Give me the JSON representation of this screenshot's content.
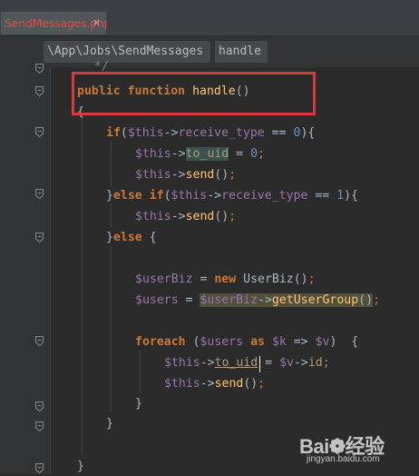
{
  "editor_tab": {
    "filename": "SendMessages.php",
    "close_glyph": "×"
  },
  "breadcrumb": {
    "path": "\\App\\Jobs\\SendMessages",
    "method": "handle"
  },
  "code": {
    "lines": [
      {
        "segments": [
          {
            "t": "  */",
            "c": "cm"
          }
        ]
      },
      {
        "segments": [
          {
            "t": "public",
            "c": "kw"
          },
          {
            "t": " ",
            "c": "pl"
          },
          {
            "t": "function",
            "c": "kw"
          },
          {
            "t": " ",
            "c": "pl"
          },
          {
            "t": "handle",
            "c": "fn"
          },
          {
            "t": "()",
            "c": "pl"
          }
        ]
      },
      {
        "segments": [
          {
            "t": "{",
            "c": "pl"
          }
        ]
      },
      {
        "segments": [
          {
            "t": "if",
            "c": "kw"
          },
          {
            "t": "(",
            "c": "pl"
          },
          {
            "t": "$this",
            "c": "var"
          },
          {
            "t": "->",
            "c": "op"
          },
          {
            "t": "receive_type",
            "c": "var"
          },
          {
            "t": " == ",
            "c": "pl"
          },
          {
            "t": "0",
            "c": "num"
          },
          {
            "t": "){",
            "c": "pl"
          }
        ]
      },
      {
        "segments": [
          {
            "t": "$this",
            "c": "var"
          },
          {
            "t": "->",
            "c": "op"
          },
          {
            "t": "to_uid",
            "c": "mth hl"
          },
          {
            "t": " = ",
            "c": "pl"
          },
          {
            "t": "0",
            "c": "num"
          },
          {
            "t": ";",
            "c": "sc"
          }
        ]
      },
      {
        "segments": [
          {
            "t": "$this",
            "c": "var"
          },
          {
            "t": "->",
            "c": "op"
          },
          {
            "t": "send",
            "c": "fn"
          },
          {
            "t": "()",
            "c": "pl"
          },
          {
            "t": ";",
            "c": "sc"
          }
        ]
      },
      {
        "segments": [
          {
            "t": "}",
            "c": "pl"
          },
          {
            "t": "else",
            "c": "kw"
          },
          {
            "t": " ",
            "c": "pl"
          },
          {
            "t": "if",
            "c": "kw"
          },
          {
            "t": "(",
            "c": "pl"
          },
          {
            "t": "$this",
            "c": "var"
          },
          {
            "t": "->",
            "c": "op"
          },
          {
            "t": "receive_type",
            "c": "var"
          },
          {
            "t": " == ",
            "c": "pl"
          },
          {
            "t": "1",
            "c": "num"
          },
          {
            "t": "){",
            "c": "pl"
          }
        ]
      },
      {
        "segments": [
          {
            "t": "$this",
            "c": "var"
          },
          {
            "t": "->",
            "c": "op"
          },
          {
            "t": "send",
            "c": "fn"
          },
          {
            "t": "()",
            "c": "pl"
          },
          {
            "t": ";",
            "c": "sc"
          }
        ]
      },
      {
        "segments": [
          {
            "t": "}",
            "c": "pl"
          },
          {
            "t": "else",
            "c": "kw"
          },
          {
            "t": " {",
            "c": "pl"
          }
        ]
      },
      {
        "segments": []
      },
      {
        "segments": [
          {
            "t": "$userBiz",
            "c": "var"
          },
          {
            "t": " = ",
            "c": "pl"
          },
          {
            "t": "new",
            "c": "kw"
          },
          {
            "t": " UserBiz()",
            "c": "pl"
          },
          {
            "t": ";",
            "c": "sc"
          }
        ]
      },
      {
        "segments": [
          {
            "t": "$users",
            "c": "var"
          },
          {
            "t": " = ",
            "c": "pl"
          },
          {
            "t": "$userBiz",
            "c": "var hlr"
          },
          {
            "t": "->",
            "c": "op hlr"
          },
          {
            "t": "getUserGroup",
            "c": "fn hlr"
          },
          {
            "t": "()",
            "c": "pl hlr"
          },
          {
            "t": ";",
            "c": "sc"
          }
        ]
      },
      {
        "segments": []
      },
      {
        "segments": [
          {
            "t": "foreach",
            "c": "kw"
          },
          {
            "t": " (",
            "c": "pl"
          },
          {
            "t": "$users",
            "c": "var"
          },
          {
            "t": " ",
            "c": "pl"
          },
          {
            "t": "as",
            "c": "kw"
          },
          {
            "t": " ",
            "c": "pl"
          },
          {
            "t": "$k",
            "c": "var"
          },
          {
            "t": " => ",
            "c": "pl"
          },
          {
            "t": "$v",
            "c": "var"
          },
          {
            "t": ")  {",
            "c": "pl"
          }
        ]
      },
      {
        "segments": [
          {
            "t": "$this",
            "c": "var"
          },
          {
            "t": "->",
            "c": "op"
          },
          {
            "t": "to_uid",
            "c": "mth ud"
          },
          {
            "t": " = ",
            "c": "pl"
          },
          {
            "t": "$v",
            "c": "var"
          },
          {
            "t": "->",
            "c": "op"
          },
          {
            "t": "id",
            "c": "mth"
          },
          {
            "t": ";",
            "c": "sc"
          }
        ]
      },
      {
        "segments": [
          {
            "t": "$this",
            "c": "var"
          },
          {
            "t": "->",
            "c": "op"
          },
          {
            "t": "send",
            "c": "fn"
          },
          {
            "t": "()",
            "c": "pl"
          },
          {
            "t": ";",
            "c": "sc"
          }
        ]
      },
      {
        "segments": [
          {
            "t": "}",
            "c": "pl"
          }
        ]
      },
      {
        "segments": [
          {
            "t": "}",
            "c": "pl"
          }
        ]
      },
      {
        "segments": []
      },
      {
        "segments": [
          {
            "t": "}",
            "c": "pl"
          }
        ]
      }
    ]
  },
  "watermark": {
    "logo": "Bai❁经验",
    "url": "jingyan.baidu.com"
  }
}
